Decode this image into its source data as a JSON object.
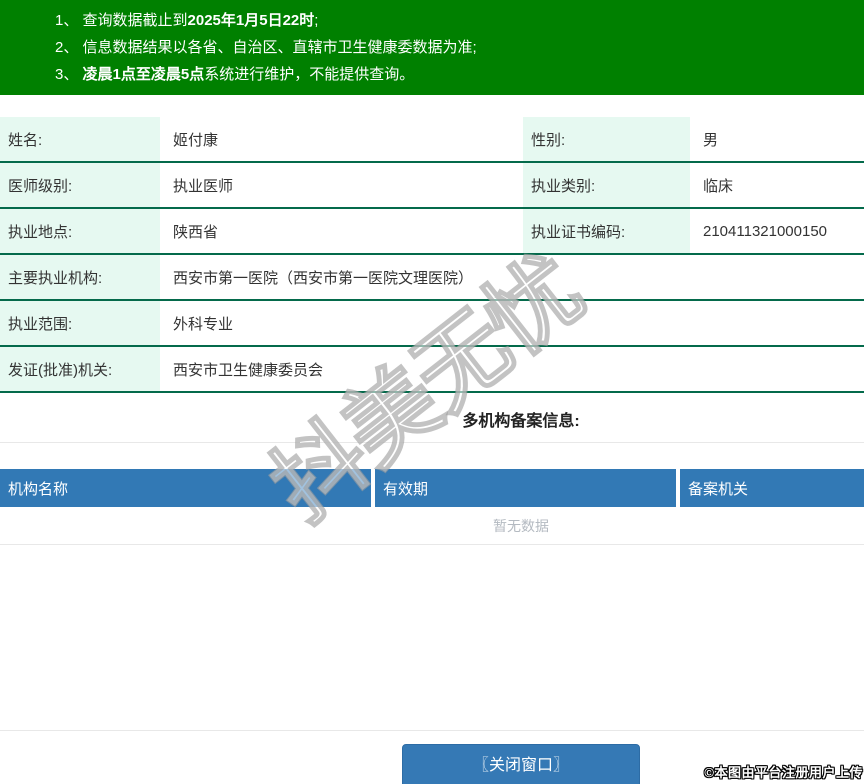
{
  "notice": {
    "line1": {
      "pre": "1、 查询数据截止到",
      "bold": "2025年1月5日22时",
      "post": ";"
    },
    "line2": {
      "pre": "2、 信息数据结果以各省、自治区、直辖市卫生健康委数据为准;",
      "bold": "",
      "post": ""
    },
    "line3": {
      "pre": "3、 ",
      "bold": "凌晨1点至凌晨5点",
      "post": "系统进行维护，不能提供查询。"
    }
  },
  "info": {
    "r1": {
      "l1": "姓名:",
      "v1": "姬付康",
      "l2": "性别:",
      "v2": "男"
    },
    "r2": {
      "l1": "医师级别:",
      "v1": "执业医师",
      "l2": "执业类别:",
      "v2": "临床"
    },
    "r3": {
      "l1": "执业地点:",
      "v1": "陕西省",
      "l2": "执业证书编码:",
      "v2": "210411321000150"
    },
    "r4": {
      "l": "主要执业机构:",
      "v": "西安市第一医院（西安市第一医院文理医院）"
    },
    "r5": {
      "l": "执业范围:",
      "v": "外科专业"
    },
    "r6": {
      "l": "发证(批准)机关:",
      "v": "西安市卫生健康委员会"
    }
  },
  "filing": {
    "title": "多机构备案信息:",
    "headers": [
      "机构名称",
      "有效期",
      "备案机关"
    ],
    "empty": "暂无数据"
  },
  "footer": {
    "close_label": "〖关闭窗口〗"
  },
  "overlay": {
    "watermark_text": "抖美无忧",
    "copyright": "©本图由平台注册用户上传"
  },
  "colors": {
    "notice_green": "#008000",
    "row_border_green": "#046a4b",
    "label_mint": "#e6f9f1",
    "table_header_blue": "#3279b5",
    "button_blue": "#3579b5",
    "empty_text_gray": "#b4bac1"
  }
}
